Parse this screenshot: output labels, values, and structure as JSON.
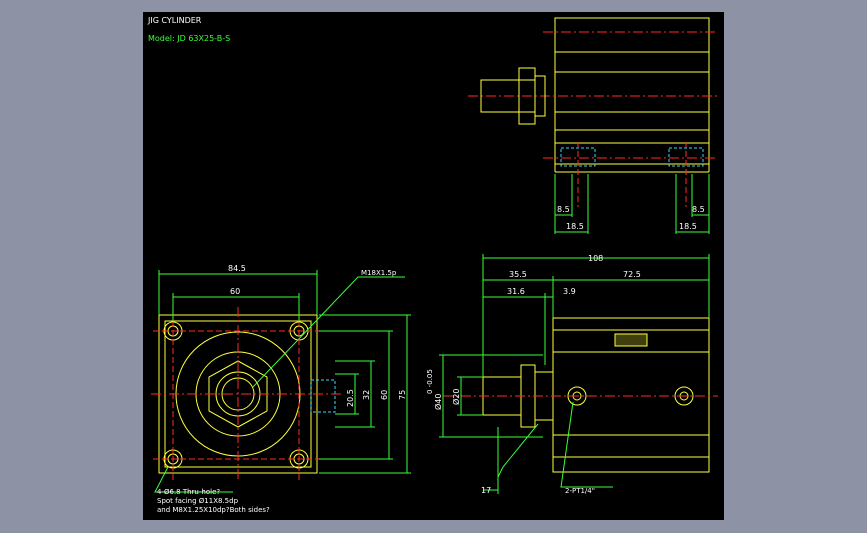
{
  "title": "JIG CYLINDER",
  "model": "Model: JD 63X25-B-S",
  "top_view": {
    "dims": {
      "left_small": "8.5",
      "left_big": "18.5",
      "right_small": "8.5",
      "right_big": "18.5"
    }
  },
  "front_view": {
    "dims": {
      "width_outer": "84.5",
      "width_inner": "60",
      "h1": "20.5",
      "h2": "32",
      "h3": "60",
      "h4": "75"
    },
    "thread_callout": "M18X1.5p",
    "notes": [
      "4-Ø6.8 Thru-hole?",
      "Spot facing Ø11X8.5dp",
      "and M8X1.25X10dp?Both sides?"
    ]
  },
  "side_view": {
    "dims": {
      "total": "108",
      "a": "35.5",
      "b": "72.5",
      "c": "31.6",
      "d": "3.9",
      "dia_a": "Ø40",
      "dia_b": "Ø20",
      "stroke": "17"
    },
    "dia_a_tol": "0 -0.05",
    "port_callout": "2-PT1/4\""
  },
  "colors": {
    "yellow": "#ffff3c",
    "green": "#39ff39",
    "red": "#ff2a2a",
    "cyan": "#38d9ff",
    "white": "#ffffff"
  }
}
